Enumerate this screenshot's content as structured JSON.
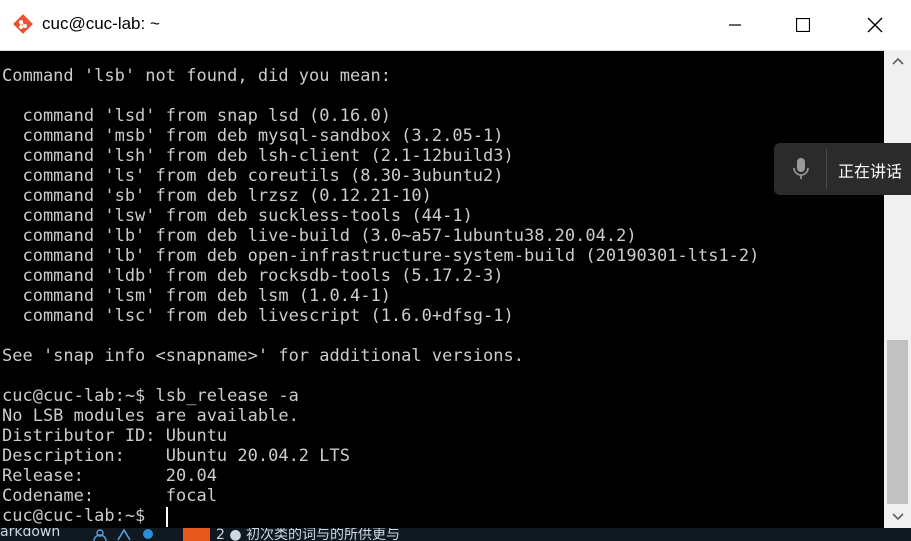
{
  "window": {
    "title": "cuc@cuc-lab: ~",
    "controls": {
      "minimize": "minimize",
      "maximize": "maximize",
      "close": "close"
    }
  },
  "terminal": {
    "lines": [
      "Command 'lsb' not found, did you mean:",
      "",
      "  command 'lsd' from snap lsd (0.16.0)",
      "  command 'msb' from deb mysql-sandbox (3.2.05-1)",
      "  command 'lsh' from deb lsh-client (2.1-12build3)",
      "  command 'ls' from deb coreutils (8.30-3ubuntu2)",
      "  command 'sb' from deb lrzsz (0.12.21-10)",
      "  command 'lsw' from deb suckless-tools (44-1)",
      "  command 'lb' from deb live-build (3.0~a57-1ubuntu38.20.04.2)",
      "  command 'lb' from deb open-infrastructure-system-build (20190301-lts1-2)",
      "  command 'ldb' from deb rocksdb-tools (5.17.2-3)",
      "  command 'lsm' from deb lsm (1.0.4-1)",
      "  command 'lsc' from deb livescript (1.6.0+dfsg-1)",
      "",
      "See 'snap info <snapname>' for additional versions.",
      "",
      "cuc@cuc-lab:~$ lsb_release -a",
      "No LSB modules are available.",
      "Distributor ID: Ubuntu",
      "Description:    Ubuntu 20.04.2 LTS",
      "Release:        20.04",
      "Codename:       focal",
      "cuc@cuc-lab:~$ "
    ]
  },
  "voice_popup": {
    "label": "正在讲话",
    "icon": "microphone-icon"
  },
  "taskbar": {
    "left_text": "arkdown",
    "right_text": "2 ● 初次类的词与的所供更与"
  },
  "colors": {
    "terminal_bg": "#000000",
    "terminal_fg": "#cccccc",
    "titlebar_bg": "#ffffff",
    "popup_bg": "#2b2b2b",
    "taskbar_accent": "#e7581c"
  }
}
